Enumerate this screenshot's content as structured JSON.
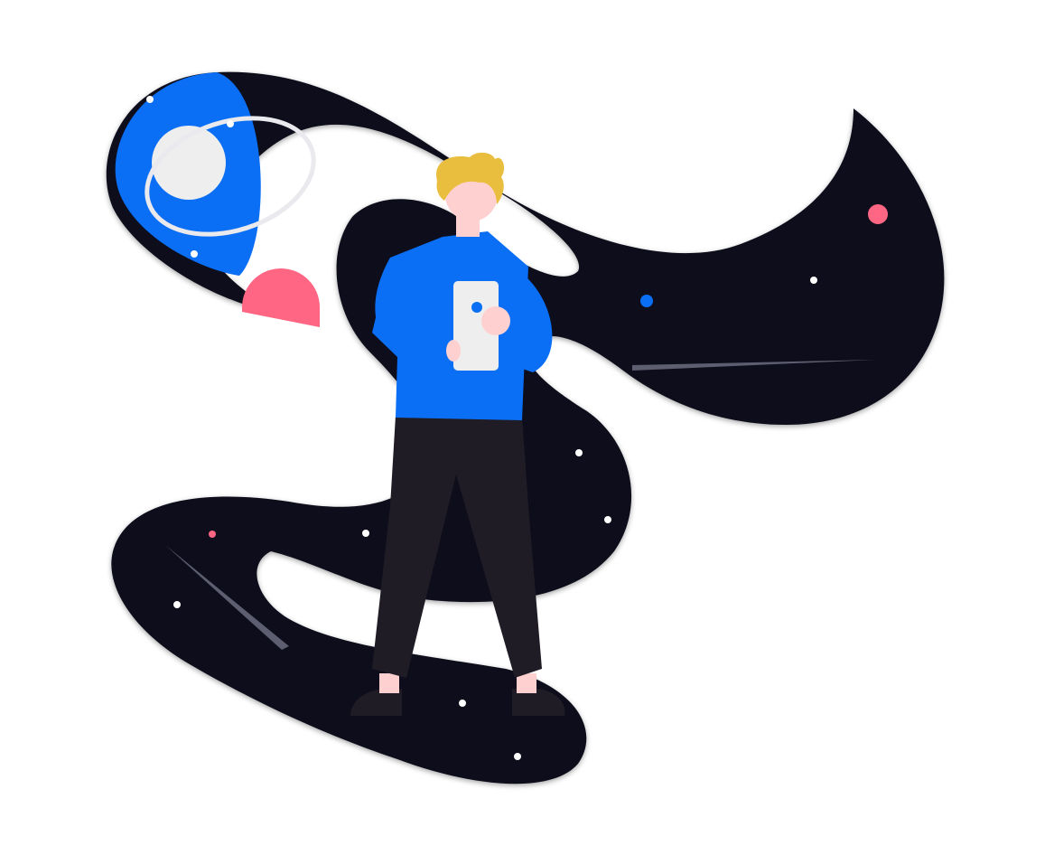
{
  "scene": {
    "subject": "person-holding-phone-in-space",
    "palette": {
      "background": "#ffffff",
      "space": "#0b0f1a",
      "accent_blue": "#0a6ff5",
      "accent_pink": "#ff6683",
      "planet_light": "#eeeeee",
      "star": "#ffffff",
      "streak": "#5d5f70",
      "hair": "#e9be3f",
      "skin": "#ffd0d0",
      "pants": "#201c25",
      "shoes": "#201c25",
      "phone": "#eeeeee"
    },
    "icons": {
      "planet": "planet-icon",
      "moon": "moon-icon",
      "person": "person-icon",
      "phone": "phone-icon",
      "star": "star-icon",
      "shooting_star": "shooting-star-icon"
    }
  }
}
